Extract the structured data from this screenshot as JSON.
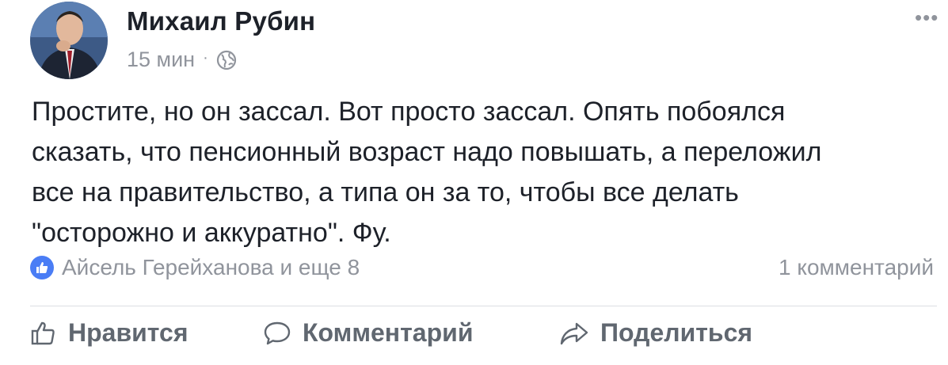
{
  "post": {
    "author": "Михаил Рубин",
    "time": "15 мин",
    "separator": "·",
    "privacy_icon": "globe-icon",
    "more_label": "•••",
    "text_lines": [
      "Простите, но он зассал. Вот просто зассал. Опять побоялся",
      "сказать, что пенсионный возраст надо повышать, а переложил",
      "все на правительство, а типа он за то, чтобы все делать",
      "\"осторожно и аккуратно\". Фу."
    ]
  },
  "reactions": {
    "icon": "like-icon",
    "text": "Айсель Герейханова и еще 8",
    "comments": "1 комментарий"
  },
  "actions": {
    "like_label": "Нравится",
    "comment_label": "Комментарий",
    "share_label": "Поделиться"
  },
  "colors": {
    "text": "#1d2129",
    "muted": "#90949c",
    "action": "#606770",
    "like_blue": "#4a7df5",
    "divider": "#dddfe2"
  }
}
